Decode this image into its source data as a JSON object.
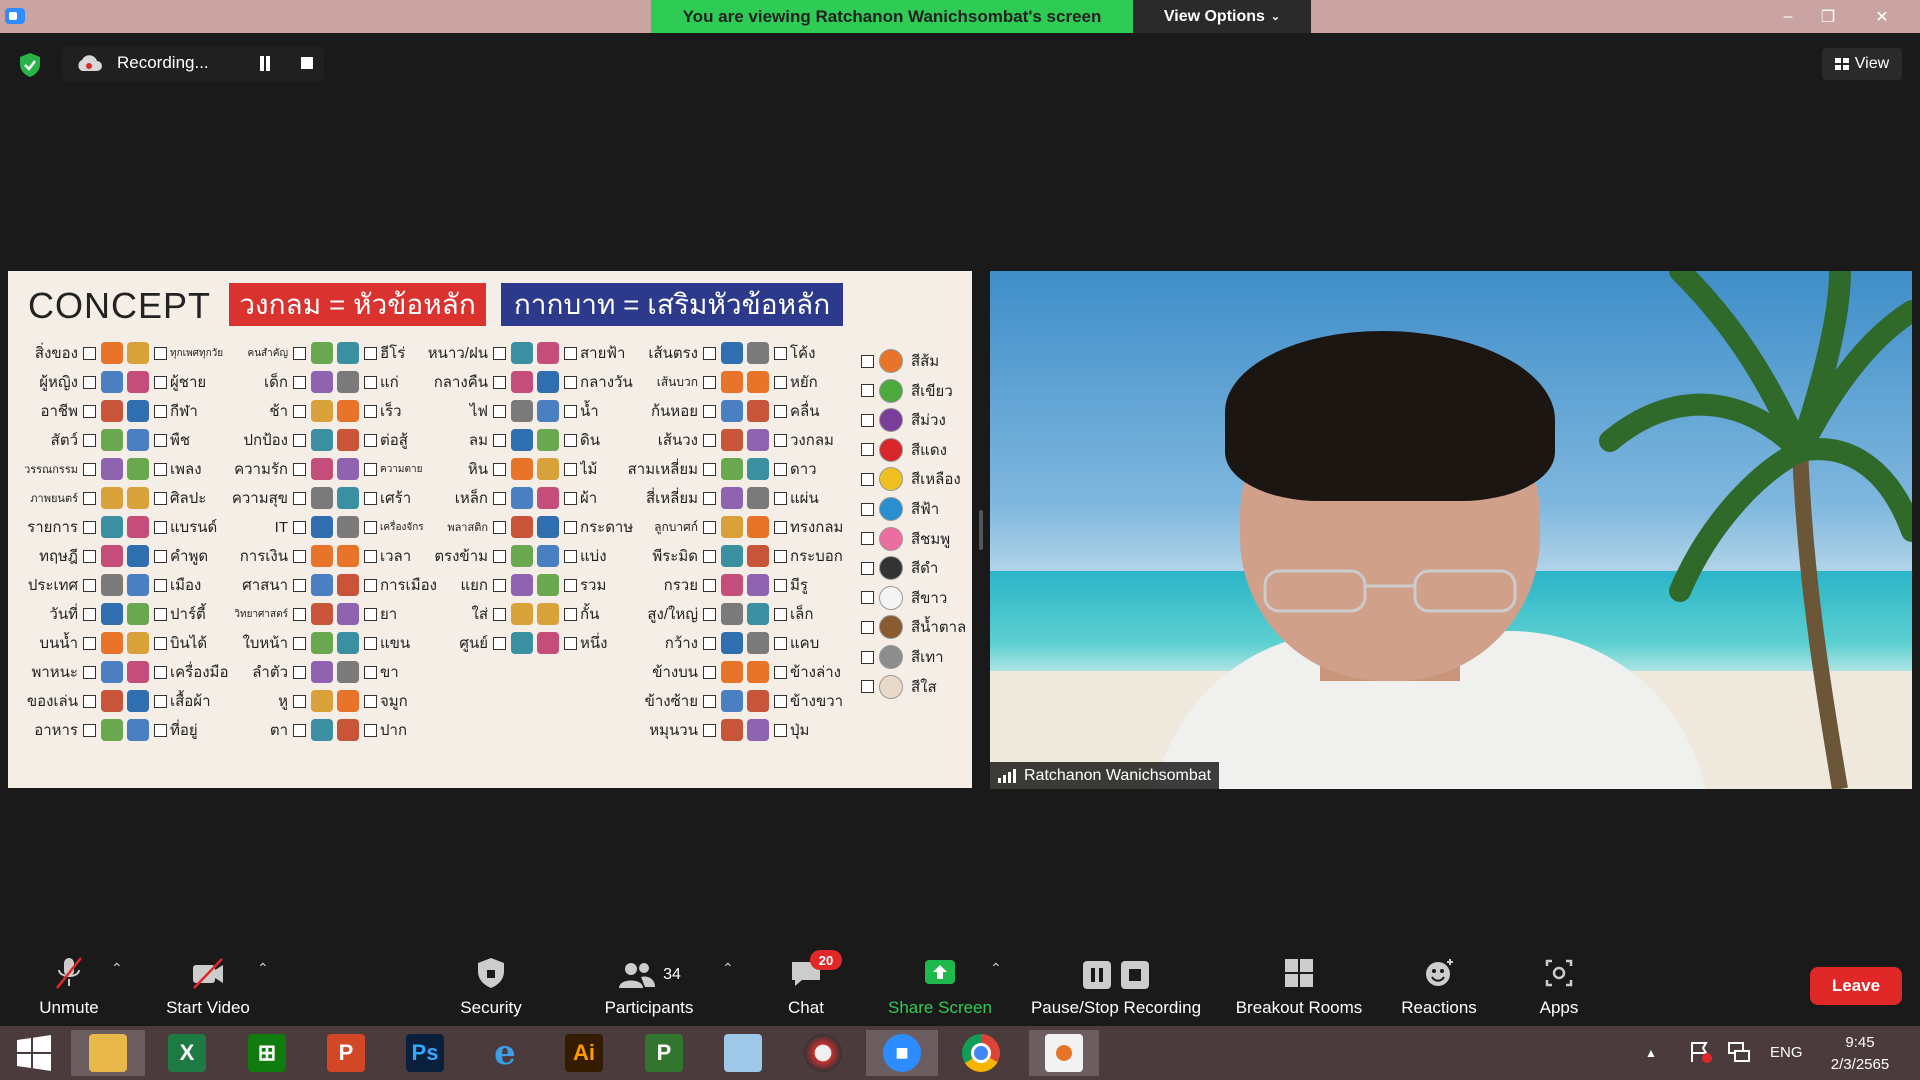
{
  "titlebar": {
    "banner_text": "You are viewing Ratchanon Wanichsombat's screen",
    "view_options_label": "View Options",
    "minimize": "–",
    "restore": "❐",
    "close": "✕"
  },
  "recording": {
    "label": "Recording..."
  },
  "view_button": {
    "label": "View"
  },
  "share": {
    "title": "CONCEPT",
    "tag_red": "วงกลม = หัวข้อหลัก",
    "tag_blue": "กากบาท = เสริมหัวข้อหลัก",
    "col1": [
      "สิ่งของ",
      "ผู้หญิง",
      "อาชีพ",
      "สัตว์",
      "วรรณกรรม",
      "ภาพยนตร์",
      "รายการ",
      "ทฤษฎี",
      "ประเทศ",
      "วันที่",
      "บนน้ำ",
      "พาหนะ",
      "ของเล่น",
      "อาหาร"
    ],
    "col1b": [
      "ทุกเพศทุกวัย",
      "ผู้ชาย",
      "กีฬา",
      "พืช",
      "เพลง",
      "ศิลปะ",
      "แบรนด์",
      "คำพูด",
      "เมือง",
      "ปาร์ตี้",
      "บินได้",
      "เครื่องมือ",
      "เสื้อผ้า",
      "ที่อยู่"
    ],
    "col2": [
      "คนสำคัญ",
      "เด็ก",
      "ช้า",
      "ปกป้อง",
      "ความรัก",
      "ความสุข",
      "IT",
      "การเงิน",
      "ศาสนา",
      "วิทยาศาสตร์",
      "ใบหน้า",
      "ลำตัว",
      "หู",
      "ตา"
    ],
    "col2b": [
      "ฮีโร่",
      "แก่",
      "เร็ว",
      "ต่อสู้",
      "ความตาย",
      "เศร้า",
      "เครื่องจักร",
      "เวลา",
      "การเมือง",
      "ยา",
      "แขน",
      "ขา",
      "จมูก",
      "ปาก"
    ],
    "col3": [
      "หนาว/ฝน",
      "กลางคืน",
      "ไฟ",
      "ลม",
      "หิน",
      "เหล็ก",
      "พลาสติก",
      "ตรงข้าม",
      "แยก",
      "ใส่",
      "ศูนย์"
    ],
    "col3b": [
      "สายฟ้า",
      "กลางวัน",
      "น้ำ",
      "ดิน",
      "ไม้",
      "ผ้า",
      "กระดาษ",
      "แบ่ง",
      "รวม",
      "กั้น",
      "หนึ่ง"
    ],
    "col4": [
      "เส้นตรง",
      "เส้นบวก",
      "ก้นหอย",
      "เส้นวง",
      "สามเหลี่ยม",
      "สี่เหลี่ยม",
      "ลูกบาศก์",
      "พีระมิด",
      "กรวย",
      "สูง/ใหญ่",
      "กว้าง",
      "ข้างบน",
      "ข้างซ้าย",
      "หมุนวน"
    ],
    "col4b": [
      "โค้ง",
      "หยัก",
      "คลื่น",
      "วงกลม",
      "ดาว",
      "แผ่น",
      "ทรงกลม",
      "กระบอก",
      "มีรู",
      "เล็ก",
      "แคบ",
      "ข้างล่าง",
      "ข้างขวา",
      "ปุ่ม"
    ],
    "colors": [
      "สีส้ม",
      "สีเขียว",
      "สีม่วง",
      "สีแดง",
      "สีเหลือง",
      "สีฟ้า",
      "สีชมพู",
      "สีดำ",
      "สีขาว",
      "สีน้ำตาล",
      "สีเทา",
      "สีใส"
    ],
    "color_swatches": [
      "#e8742a",
      "#4caa3c",
      "#7a3d9a",
      "#d8262a",
      "#f0c020",
      "#2a8fd0",
      "#ec6ea0",
      "#333333",
      "#f4f4f4",
      "#8a5a30",
      "#8d8d8d",
      "#e9d9c8"
    ]
  },
  "video": {
    "participant_name": "Ratchanon Wanichsombat"
  },
  "toolbar": {
    "unmute": "Unmute",
    "start_video": "Start Video",
    "security": "Security",
    "participants": "Participants",
    "participants_count": "34",
    "chat": "Chat",
    "chat_badge": "20",
    "share_screen": "Share Screen",
    "pause_stop": "Pause/Stop Recording",
    "breakout": "Breakout Rooms",
    "reactions": "Reactions",
    "apps": "Apps",
    "leave": "Leave"
  },
  "taskbar": {
    "apps": [
      "windows-start",
      "file-explorer",
      "excel",
      "store",
      "powerpoint",
      "photoshop",
      "internet-explorer",
      "illustrator",
      "project",
      "notepad",
      "photoscape",
      "zoom",
      "chrome",
      "paint-app"
    ],
    "ps_label": "Ps",
    "ai_label": "Ai",
    "lang": "ENG",
    "time": "9:45",
    "date": "2/3/2565"
  },
  "colors": {
    "banner_green": "#2ecc55",
    "leave_red": "#e02828",
    "share_green": "#1fb84a",
    "titlebar": "#caa3a3",
    "taskbar": "#4c3b3d"
  }
}
